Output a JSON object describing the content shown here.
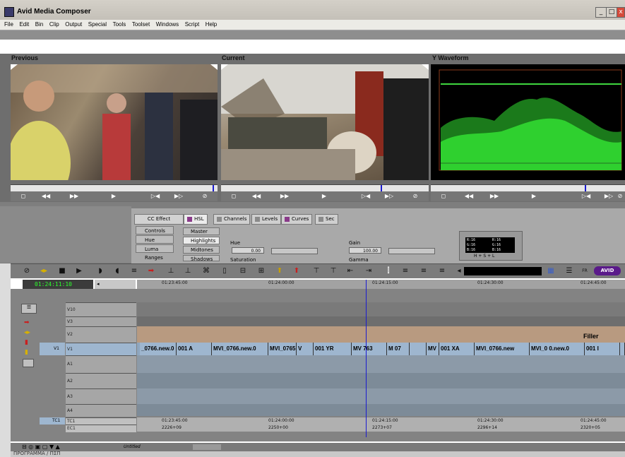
{
  "app": {
    "title": "Avid Media Composer"
  },
  "menu": [
    "File",
    "Edit",
    "Bin",
    "Clip",
    "Output",
    "Special",
    "Tools",
    "Toolset",
    "Windows",
    "Script",
    "Help"
  ],
  "monitors": {
    "previous": "Previous",
    "current": "Current",
    "waveform": "Y Waveform"
  },
  "cc": {
    "title": "CC Effect",
    "tabs": [
      "HSL",
      "Channels",
      "Levels",
      "Curves",
      "Sec"
    ],
    "left_buttons": [
      "Controls",
      "Hue Offsets",
      "Luma Ranges"
    ],
    "hsl_buttons": [
      "Master",
      "Highlights",
      "Midtones",
      "Shadows"
    ],
    "hue_label": "Hue",
    "hue_value": "0.00",
    "gain_label": "Gain",
    "gain_value": "100.00",
    "saturation_label": "Saturation",
    "gamma_label": "Gamma",
    "rgb_readout": [
      "R:16",
      "G:16",
      "B:16",
      "R:16",
      "G:16",
      "B:16"
    ],
    "dropdown": "H + S + L"
  },
  "timeline": {
    "timecode": "01:24:11:10",
    "ruler": [
      "01:23:45:00",
      "01:24:00:00",
      "01:24:15:00",
      "01:24:30:00",
      "01:24:45:00"
    ],
    "tracks": [
      {
        "name": "V10"
      },
      {
        "name": "V3"
      },
      {
        "name": "V2",
        "filler": "Filler"
      },
      {
        "name": "V1",
        "source": "V1"
      },
      {
        "name": "A1"
      },
      {
        "name": "A2"
      },
      {
        "name": "A3"
      },
      {
        "name": "A4"
      },
      {
        "name": "TC1",
        "source": "TC1"
      },
      {
        "name": "EC1"
      }
    ],
    "v1_clips": [
      "_0766.new.0",
      "001 A",
      "MVI_0766.new.0",
      "MVI_0765",
      "V",
      "001 YR",
      "MV 763",
      "M 07",
      "",
      "MV",
      "001 XA",
      "MVI_0766.new",
      "MVI_0 0.new.0",
      "001 I",
      ""
    ],
    "tc1": [
      "01:23:45:00",
      "01:24:00:00",
      "01:24:15:00",
      "01:24:30:00",
      "01:24:45:00"
    ],
    "ec1": [
      "2226+09",
      "2250+00",
      "2273+07",
      "2296+14",
      "2320+05"
    ],
    "untitled": "Untitled"
  },
  "bin_tab": "ΠΡΟΓΡΑΜΜΑ  /  ΠΣΠ"
}
